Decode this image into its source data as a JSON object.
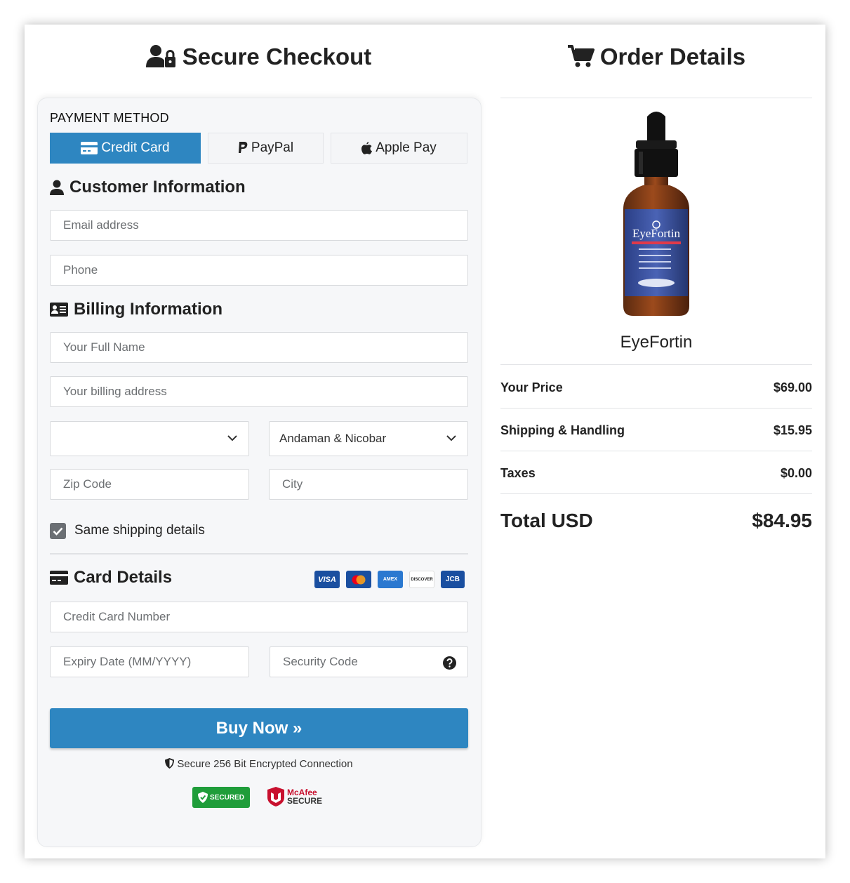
{
  "checkout": {
    "title": "Secure Checkout",
    "payment_method_label": "PAYMENT METHOD",
    "tabs": [
      {
        "label": "Credit Card",
        "icon": "credit-card-icon",
        "active": true
      },
      {
        "label": "PayPal",
        "icon": "paypal-icon",
        "active": false
      },
      {
        "label": "Apple Pay",
        "icon": "apple-icon",
        "active": false
      }
    ],
    "customer": {
      "title": "Customer Information",
      "email_placeholder": "Email address",
      "phone_placeholder": "Phone"
    },
    "billing": {
      "title": "Billing Information",
      "name_placeholder": "Your Full Name",
      "address_placeholder": "Your billing address",
      "country_value": "",
      "state_value": "Andaman & Nicobar",
      "zip_placeholder": "Zip Code",
      "city_placeholder": "City",
      "same_shipping_label": "Same shipping details",
      "same_shipping_checked": true
    },
    "card": {
      "title": "Card Details",
      "brands": [
        "VISA",
        "Mastercard",
        "AMEX",
        "DISCOVER",
        "JCB"
      ],
      "number_placeholder": "Credit Card Number",
      "expiry_placeholder": "Expiry Date (MM/YYYY)",
      "cvv_placeholder": "Security Code"
    },
    "buy_label": "Buy Now »",
    "secure_text": "Secure 256 Bit Encrypted Connection",
    "badges": {
      "trust_guard": "SECURED",
      "mcafee_line1": "McAfee",
      "mcafee_line2": "SECURE"
    }
  },
  "order": {
    "title": "Order Details",
    "product_name": "EyeFortin",
    "bottle_brand": "EyeFortin",
    "rows": [
      {
        "label": "Your Price",
        "value": "$69.00"
      },
      {
        "label": "Shipping & Handling",
        "value": "$15.95"
      },
      {
        "label": "Taxes",
        "value": "$0.00"
      }
    ],
    "total_label": "Total USD",
    "total_value": "$84.95"
  },
  "colors": {
    "accent": "#2e86c1",
    "panel_bg": "#f6f7f9",
    "text": "#222222"
  }
}
